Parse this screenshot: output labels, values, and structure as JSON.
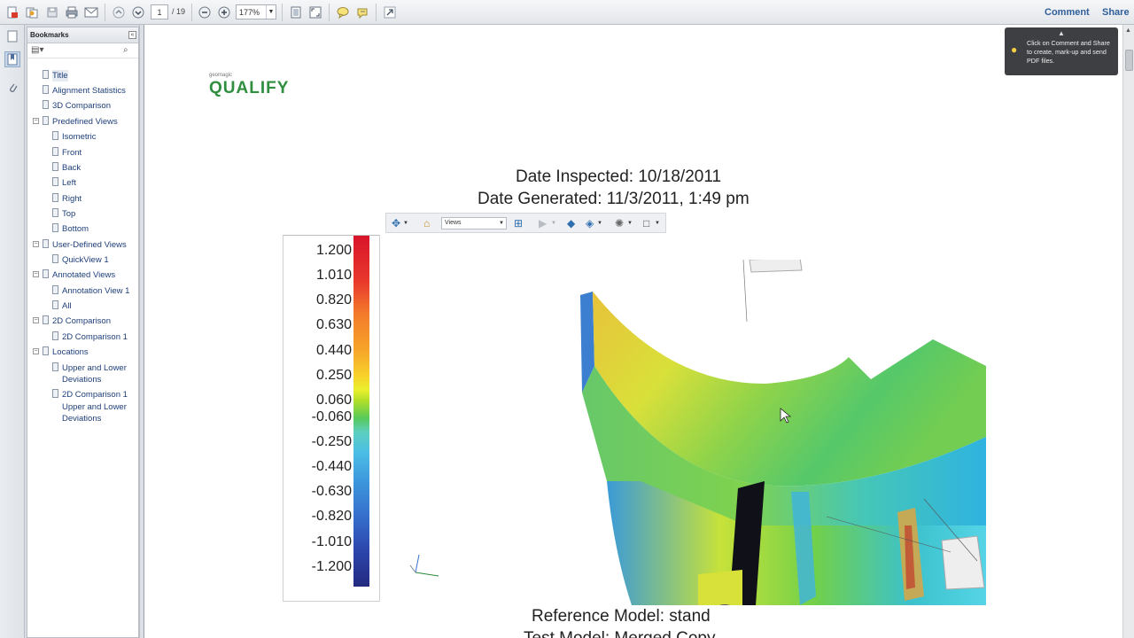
{
  "toolbar": {
    "page_current": "1",
    "page_total": "/ 19",
    "zoom": "177%",
    "comment_label": "Comment",
    "share_label": "Share"
  },
  "bookmarks": {
    "title": "Bookmarks",
    "items": [
      "Title",
      "Alignment Statistics",
      "3D Comparison",
      "Predefined Views",
      "Isometric",
      "Front",
      "Back",
      "Left",
      "Right",
      "Top",
      "Bottom",
      "User-Defined Views",
      "QuickView 1",
      "Annotated Views",
      "Annotation View 1",
      "All",
      "2D Comparison",
      "2D Comparison 1",
      "Locations",
      "Upper and Lower",
      "Deviations",
      "2D Comparison 1",
      "Upper and Lower",
      "Deviations"
    ]
  },
  "document": {
    "logo_small": "geomagic",
    "logo_big": "QUALIFY",
    "date_inspected": "Date Inspected: 10/18/2011",
    "date_generated": "Date Generated: 11/3/2011, 1:49 pm",
    "reference_model": "Reference Model: stand",
    "test_model": "Test Model: Merged Copy"
  },
  "viewer3d": {
    "views_label": "Views"
  },
  "legend": {
    "values": [
      "1.200",
      "1.010",
      "0.820",
      "0.630",
      "0.440",
      "0.250",
      "0.060",
      "-0.060",
      "-0.250",
      "-0.440",
      "-0.630",
      "-0.820",
      "-1.010",
      "-1.200"
    ]
  },
  "tooltip": {
    "text": "Click on Comment and Share to create, mark-up and send PDF files."
  },
  "colors": {
    "link": "#2f5e99",
    "logo_green": "#2f8e3f",
    "tooltip_bg": "#3d3f42"
  }
}
